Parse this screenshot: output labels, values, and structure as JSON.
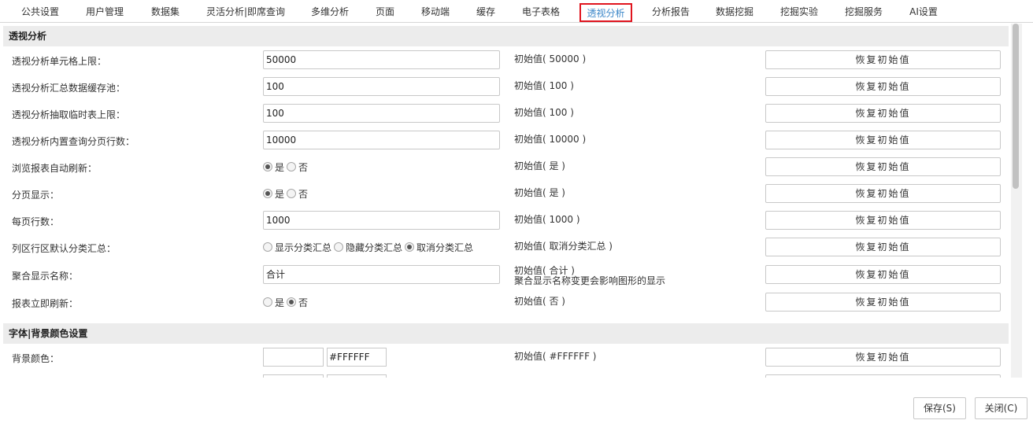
{
  "tabs": [
    {
      "label": "公共设置"
    },
    {
      "label": "用户管理"
    },
    {
      "label": "数据集"
    },
    {
      "label": "灵活分析|即席查询"
    },
    {
      "label": "多维分析"
    },
    {
      "label": "页面"
    },
    {
      "label": "移动端"
    },
    {
      "label": "缓存"
    },
    {
      "label": "电子表格"
    },
    {
      "label": "透视分析",
      "active": true
    },
    {
      "label": "分析报告"
    },
    {
      "label": "数据挖掘"
    },
    {
      "label": "挖掘实验"
    },
    {
      "label": "挖掘服务"
    },
    {
      "label": "AI设置"
    }
  ],
  "reset_label": "恢复初始值",
  "section1": {
    "title": "透视分析",
    "rows": [
      {
        "label": "透视分析单元格上限：",
        "value": "50000",
        "initial": "初始值( 50000 )"
      },
      {
        "label": "透视分析汇总数据缓存池：",
        "value": "100",
        "initial": "初始值( 100 )"
      },
      {
        "label": "透视分析抽取临时表上限：",
        "value": "100",
        "initial": "初始值( 100 )"
      },
      {
        "label": "透视分析内置查询分页行数：",
        "value": "10000",
        "initial": "初始值( 10000 )"
      },
      {
        "label": "浏览报表自动刷新：",
        "options": [
          {
            "label": "是",
            "checked": true
          },
          {
            "label": "否",
            "checked": false
          }
        ],
        "initial": "初始值( 是 )"
      },
      {
        "label": "分页显示：",
        "options": [
          {
            "label": "是",
            "checked": true
          },
          {
            "label": "否",
            "checked": false
          }
        ],
        "initial": "初始值( 是 )"
      },
      {
        "label": "每页行数：",
        "value": "1000",
        "initial": "初始值( 1000 )"
      },
      {
        "label": "列区行区默认分类汇总：",
        "options": [
          {
            "label": "显示分类汇总",
            "checked": false
          },
          {
            "label": "隐藏分类汇总",
            "checked": false
          },
          {
            "label": "取消分类汇总",
            "checked": true
          }
        ],
        "initial": "初始值( 取消分类汇总 )"
      },
      {
        "label": "聚合显示名称：",
        "value": "合计",
        "initial": "初始值( 合计 )",
        "note": "聚合显示名称变更会影响图形的显示"
      },
      {
        "label": "报表立即刷新：",
        "options": [
          {
            "label": "是",
            "checked": false
          },
          {
            "label": "否",
            "checked": true
          }
        ],
        "initial": "初始值( 否 )"
      }
    ]
  },
  "section2": {
    "title": "字体|背景颜色设置",
    "rows": [
      {
        "label": "背景颜色：",
        "color": "#FFFFFF",
        "hex": "#FFFFFF",
        "initial": "初始值( #FFFFFF )"
      }
    ]
  },
  "footer": {
    "save_label": "保存(S)",
    "close_label": "关闭(C)"
  }
}
